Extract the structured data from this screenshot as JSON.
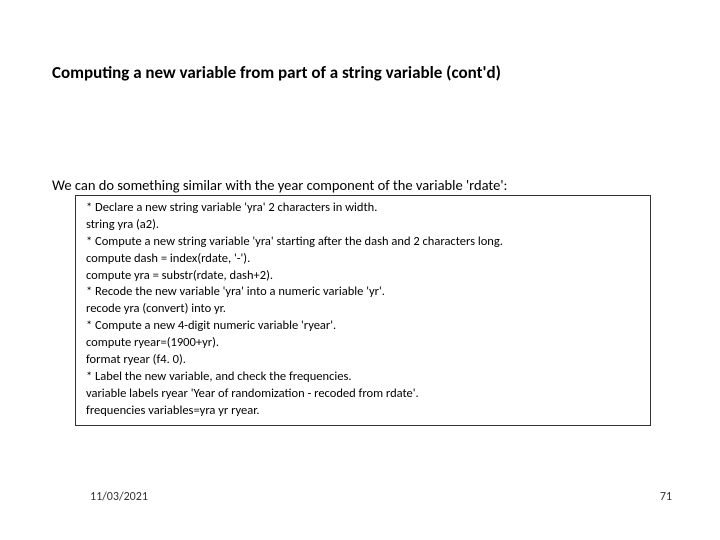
{
  "title": "Computing a new variable from part of a string variable (cont'd)",
  "intro": "We can do something similar with the year component of the variable 'rdate':",
  "code": {
    "l0": "* Declare a new string variable 'yra' 2 characters in width.",
    "l1": "string yra (a2).",
    "l2": "* Compute a new string variable 'yra' starting after the dash and 2 characters long.",
    "l3": "compute dash = index(rdate, '-').",
    "l4": "compute yra = substr(rdate, dash+2).",
    "l5": "* Recode the new variable 'yra' into a numeric variable 'yr'.",
    "l6": "recode yra (convert) into yr.",
    "l7": "* Compute a new 4-digit numeric variable 'ryear'.",
    "l8": "compute ryear=(1900+yr).",
    "l9": "format ryear (f4. 0).",
    "l10": "* Label the new variable, and check the frequencies.",
    "l11": "variable labels ryear 'Year of randomization - recoded from rdate'.",
    "l12": "frequencies variables=yra yr ryear."
  },
  "footer": {
    "date": "11/03/2021",
    "page": "71"
  }
}
